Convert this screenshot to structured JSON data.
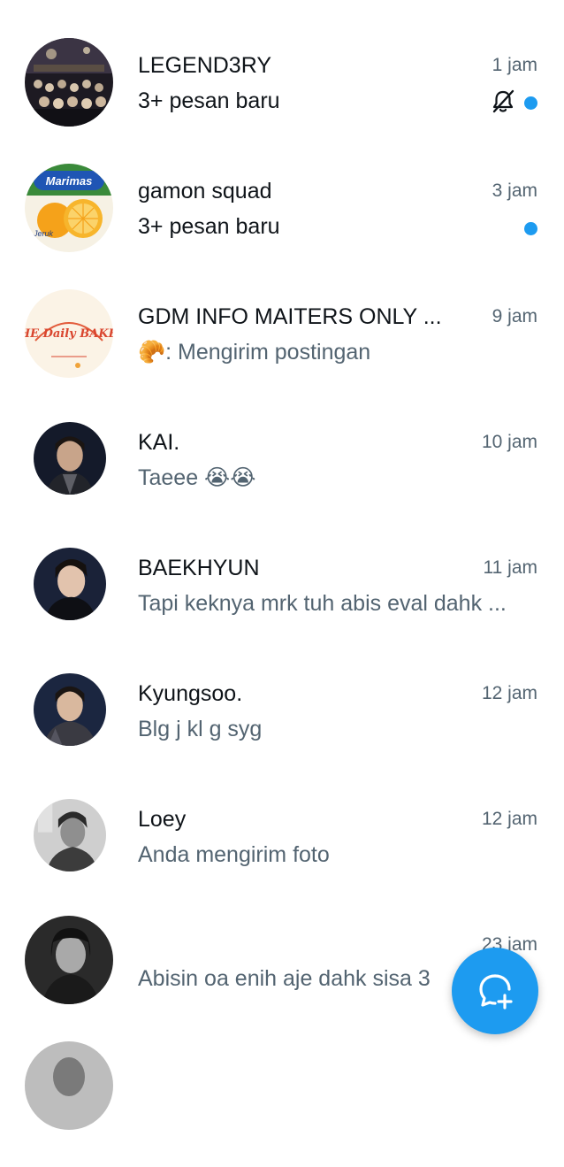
{
  "colors": {
    "accent": "#1d9bf0",
    "text_primary": "#0f1419",
    "text_secondary": "#536471",
    "background": "#ffffff"
  },
  "conversations": [
    {
      "name": "LEGEND3RY",
      "time": "1 jam",
      "preview": "3+ pesan baru",
      "unread": true,
      "muted": true,
      "avatar": "concert-crowd-photo"
    },
    {
      "name": "gamon squad",
      "time": "3 jam",
      "preview": "3+ pesan baru",
      "unread": true,
      "muted": false,
      "avatar": "orange-drink-photo",
      "avatar_text": "Marimas",
      "avatar_subtext": "Jeruk"
    },
    {
      "name": "GDM INFO MAITERS ONLY ...",
      "time": "9 jam",
      "preview_emoji": "🥐",
      "preview": ": Mengirim postingan",
      "unread": false,
      "avatar": "daily-baked-logo",
      "avatar_text": "THE Daily BAKED"
    },
    {
      "name": "KAI.",
      "time": "10 jam",
      "preview": "Taeee 😭😭",
      "unread": false,
      "avatar": "portrait-photo"
    },
    {
      "name": "BAEKHYUN",
      "time": "11 jam",
      "preview": "Tapi keknya mrk tuh abis eval dahk ...",
      "unread": false,
      "avatar": "portrait-photo"
    },
    {
      "name": "Kyungsoo.",
      "time": "12 jam",
      "preview": "Blg j kl g syg",
      "unread": false,
      "avatar": "portrait-photo"
    },
    {
      "name": "Loey",
      "time": "12 jam",
      "preview": "Anda mengirim foto",
      "unread": false,
      "avatar": "grayscale-portrait-photo"
    },
    {
      "name": "",
      "time": "23 jam",
      "preview": "Abisin oa enih aje dahk sisa 3",
      "unread": false,
      "avatar": "grayscale-portrait-photo"
    }
  ],
  "fab": {
    "icon": "new-message-icon"
  }
}
